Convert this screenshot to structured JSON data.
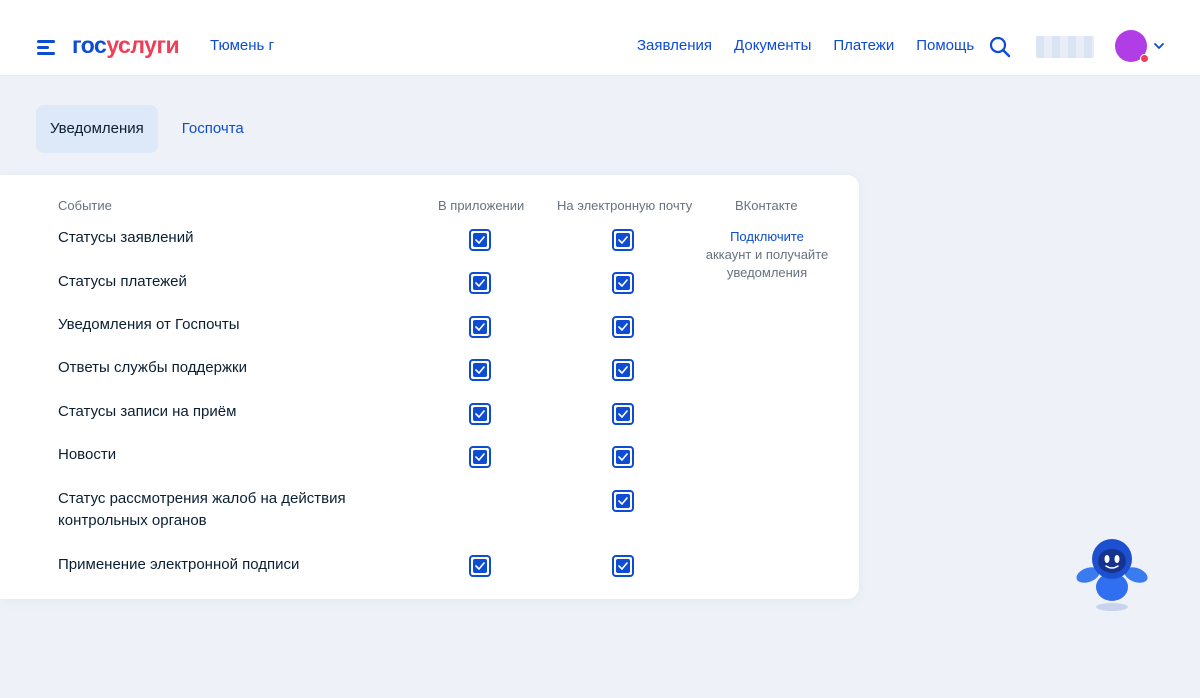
{
  "header": {
    "logo_part1": "гос",
    "logo_part2": "услуги",
    "city": "Тюмень г",
    "nav": [
      "Заявления",
      "Документы",
      "Платежи",
      "Помощь"
    ],
    "icons": {
      "menu": "burger-menu-icon",
      "search": "search-icon",
      "chevron": "chevron-down-icon"
    },
    "avatar_color": "#b13de6",
    "notification_dot_color": "#ee3f58"
  },
  "tabs": [
    {
      "label": "Уведомления",
      "active": true
    },
    {
      "label": "Госпочта",
      "active": false
    }
  ],
  "table": {
    "columns": [
      "Событие",
      "В приложении",
      "На электронную почту",
      "ВКонтакте"
    ],
    "rows": [
      {
        "label": "Статусы заявлений",
        "app": true,
        "email": true
      },
      {
        "label": "Статусы платежей",
        "app": true,
        "email": true
      },
      {
        "label": "Уведомления от Госпочты",
        "app": true,
        "email": true
      },
      {
        "label": "Ответы службы поддержки",
        "app": true,
        "email": true
      },
      {
        "label": "Статусы записи на приём",
        "app": true,
        "email": true
      },
      {
        "label": "Новости",
        "app": true,
        "email": true
      },
      {
        "label": "Статус рассмотрения жалоб на действия контрольных органов",
        "app": null,
        "email": true
      },
      {
        "label": "Применение электронной подписи",
        "app": true,
        "email": true
      }
    ],
    "vk": {
      "link": "Подключите",
      "text": "аккаунт и получайте уведомления"
    }
  },
  "colors": {
    "accent": "#0d4cd3",
    "brand_red": "#ee3f58",
    "text": "#0b1f33",
    "muted": "#66727f"
  }
}
